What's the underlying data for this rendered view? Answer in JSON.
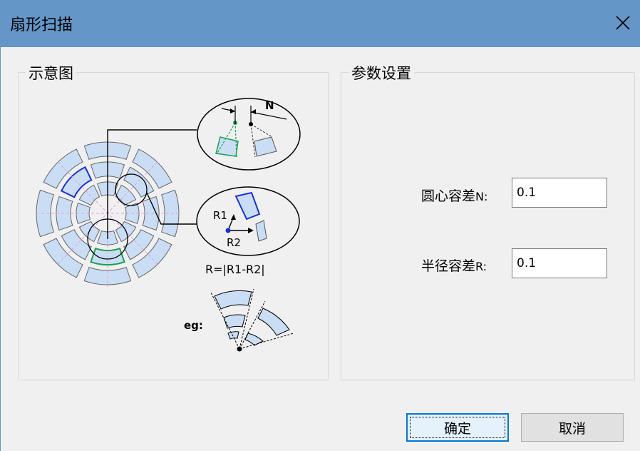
{
  "window": {
    "title": "扇形扫描"
  },
  "diagram_group": {
    "legend": "示意图",
    "labels": {
      "n": "N",
      "r1": "R1",
      "r2": "R2",
      "formula": "R=|R1-R2|",
      "eg": "eg:"
    }
  },
  "params_group": {
    "legend": "参数设置",
    "center_tolerance": {
      "label": "圆心容差",
      "suffix": "N:",
      "value": "0.1"
    },
    "radius_tolerance": {
      "label": "半径容差",
      "suffix": "R:",
      "value": "0.1"
    }
  },
  "buttons": {
    "ok": "确定",
    "cancel": "取消"
  },
  "colors": {
    "titlebar": "#6496c8",
    "sector_fill": "#c9def5",
    "highlight_blue": "#1a2ee0",
    "highlight_green": "#1aa050",
    "dashed_pink": "#e0a0d8"
  }
}
